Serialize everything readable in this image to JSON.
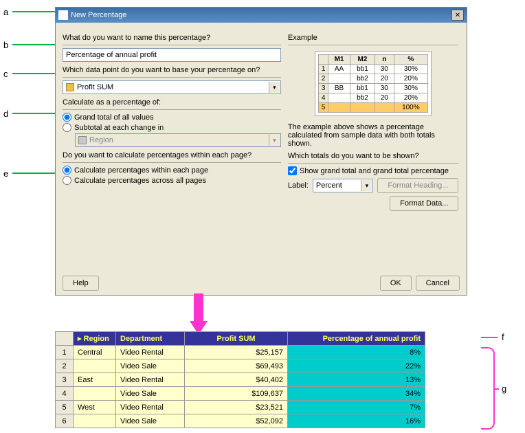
{
  "annotations": {
    "a": "a",
    "b": "b",
    "c": "c",
    "d": "d",
    "e": "e",
    "f": "f",
    "g": "g"
  },
  "dialog": {
    "title": "New Percentage",
    "q_name": "What do you want to name this percentage?",
    "name_value": "Percentage of annual profit",
    "q_datapoint": "Which data point do you want to base your percentage on?",
    "datapoint_value": "Profit SUM",
    "q_as_pct": "Calculate as a percentage of:",
    "radio_grand": "Grand total of all values",
    "radio_subtotal": "Subtotal at each change in",
    "subtotal_combo": "Region",
    "q_pages": "Do you want to calculate percentages within each page?",
    "radio_within": "Calculate percentages within each page",
    "radio_across": "Calculate percentages across all pages",
    "example_heading": "Example",
    "example_desc": "The example above shows a percentage calculated from sample data with both totals shown.",
    "q_totals": "Which totals do you want to be shown?",
    "check_show_grand": "Show grand total and grand total percentage",
    "label_text": "Label:",
    "label_value": "Percent",
    "btn_format_heading": "Format Heading...",
    "btn_format_data": "Format Data...",
    "btn_help": "Help",
    "btn_ok": "OK",
    "btn_cancel": "Cancel"
  },
  "example_table": {
    "headers": [
      "",
      "M1",
      "M2",
      "n",
      "%"
    ],
    "rows": [
      [
        "1",
        "AA",
        "bb1",
        "30",
        "30%"
      ],
      [
        "2",
        "",
        "bb2",
        "20",
        "20%"
      ],
      [
        "3",
        "BB",
        "bb1",
        "30",
        "30%"
      ],
      [
        "4",
        "",
        "bb2",
        "20",
        "20%"
      ],
      [
        "5",
        "",
        "",
        "",
        "100%"
      ]
    ]
  },
  "result_table": {
    "headers": [
      "",
      "Region",
      "Department",
      "Profit SUM",
      "Percentage of annual profit"
    ],
    "rows": [
      {
        "n": "1",
        "region": "Central",
        "dept": "Video Rental",
        "profit": "$25,157",
        "pct": "8%"
      },
      {
        "n": "2",
        "region": "",
        "dept": "Video Sale",
        "profit": "$69,493",
        "pct": "22%"
      },
      {
        "n": "3",
        "region": "East",
        "dept": "Video Rental",
        "profit": "$40,402",
        "pct": "13%"
      },
      {
        "n": "4",
        "region": "",
        "dept": "Video Sale",
        "profit": "$109,637",
        "pct": "34%"
      },
      {
        "n": "5",
        "region": "West",
        "dept": "Video Rental",
        "profit": "$23,521",
        "pct": "7%"
      },
      {
        "n": "6",
        "region": "",
        "dept": "Video Sale",
        "profit": "$52,092",
        "pct": "16%"
      }
    ]
  }
}
